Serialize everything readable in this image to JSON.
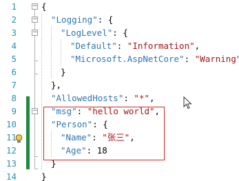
{
  "editor": {
    "line_numbers": [
      "1",
      "2",
      "3",
      "4",
      "5",
      "6",
      "7",
      "8",
      "9",
      "10",
      "11",
      "12",
      "13",
      "14"
    ],
    "lines": {
      "l1": {
        "brace": "{"
      },
      "l2": {
        "key": "\"Logging\"",
        "punct": ": {"
      },
      "l3": {
        "key": "\"LogLevel\"",
        "punct": ": {"
      },
      "l4": {
        "key": "\"Default\"",
        "punct": ": ",
        "value": "\"Information\"",
        "tail": ","
      },
      "l5": {
        "key": "\"Microsoft.AspNetCore\"",
        "punct": ": ",
        "value": "\"Warning\""
      },
      "l6": {
        "brace": "}"
      },
      "l7": {
        "brace": "},"
      },
      "l8": {
        "key": "\"AllowedHosts\"",
        "punct": ": ",
        "value": "\"*\"",
        "tail": ","
      },
      "l9": {
        "key": "\"msg\"",
        "punct": ": ",
        "value": "\"hello world\"",
        "tail": ","
      },
      "l10": {
        "key": "\"Person\"",
        "punct": ": {"
      },
      "l11": {
        "key": "\"Name\"",
        "punct": ": ",
        "value": "\"张三\"",
        "tail": ","
      },
      "l12": {
        "key": "\"Age\"",
        "punct": ": ",
        "number": "18"
      },
      "l13": {
        "brace": "}"
      },
      "l14": {
        "brace": "}"
      }
    },
    "fold_markers": [
      "−",
      "−",
      "−",
      "−"
    ],
    "colors": {
      "key": "#2e75b6",
      "string": "#a31515",
      "line_number": "#2b91af",
      "change_bar": "#1e8a3e",
      "highlight_box": "#d9201f"
    },
    "icons": {
      "lightbulb": "lightbulb-icon",
      "cursor": "mouse-pointer-icon"
    }
  }
}
